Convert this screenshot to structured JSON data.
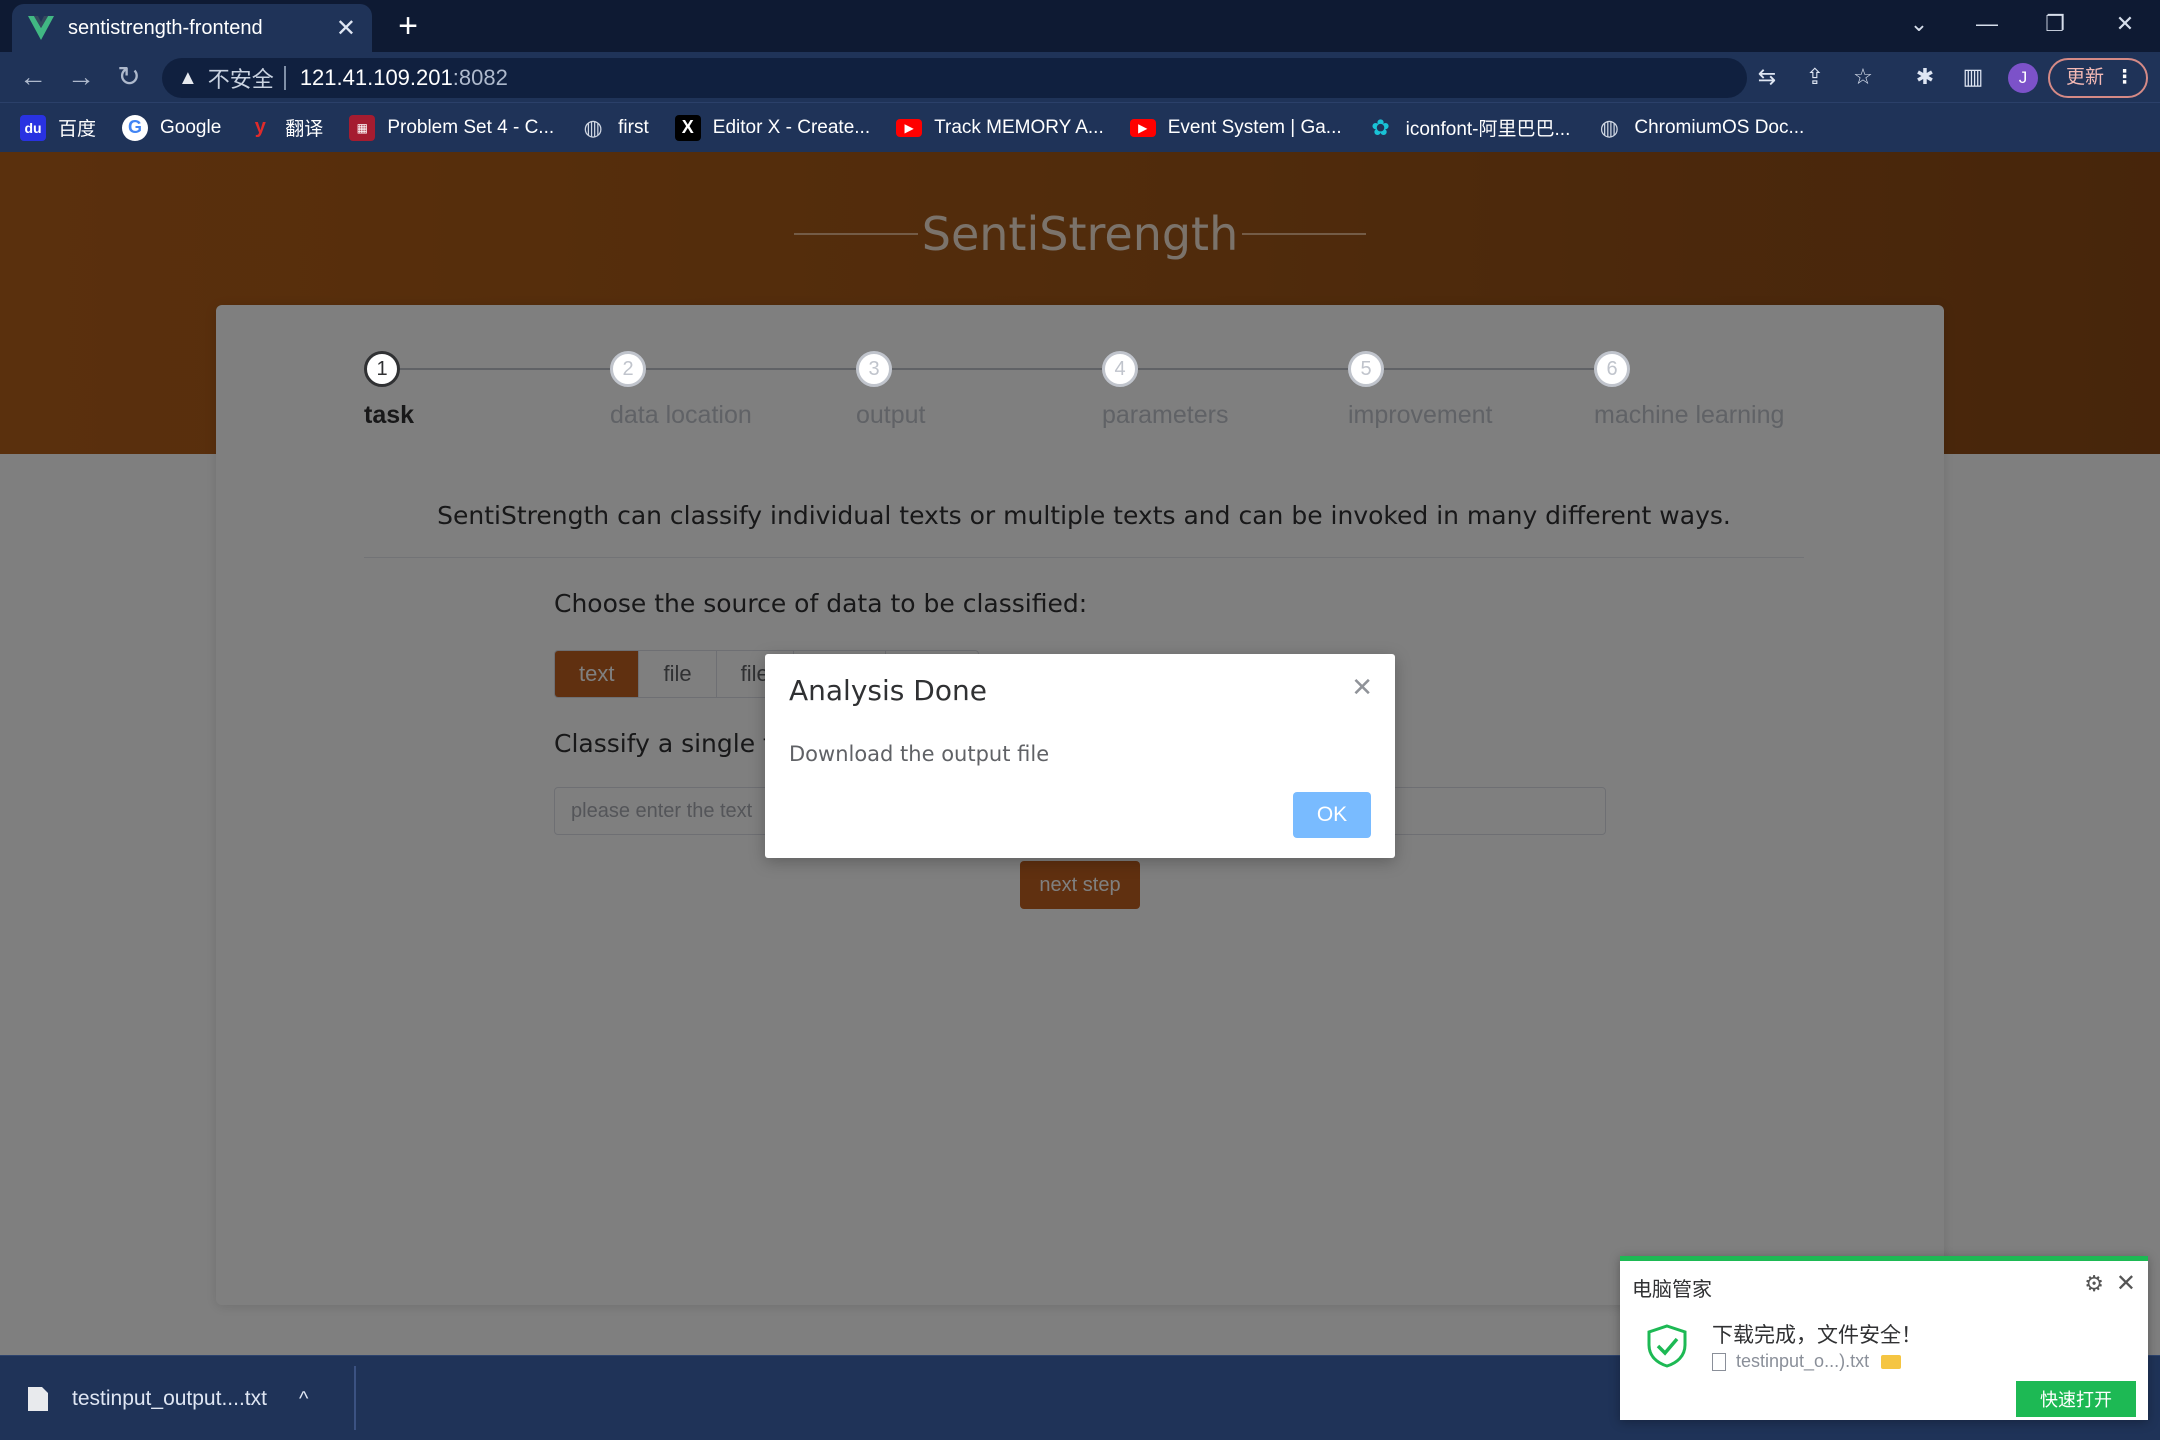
{
  "browser": {
    "tab_title": "sentistrength-frontend",
    "tab_close": "✕",
    "new_tab": "+",
    "address": {
      "security_label": "不安全",
      "host": "121.41.109.201",
      "port": ":8082"
    },
    "update_label": "更新",
    "profile_initial": "J",
    "bookmarks": [
      {
        "label": "百度",
        "icon": "baidu-icon",
        "color": "#2932e1"
      },
      {
        "label": "Google",
        "icon": "google-icon",
        "color": "#ffffff"
      },
      {
        "label": "翻译",
        "icon": "youdao-icon",
        "color": "#e02b2b"
      },
      {
        "label": "Problem Set 4 - C...",
        "icon": "harvard-icon",
        "color": "#a51c30"
      },
      {
        "label": "first",
        "icon": "globe-icon",
        "color": "#9aa5b8"
      },
      {
        "label": "Editor X - Create...",
        "icon": "editorx-icon",
        "color": "#000000"
      },
      {
        "label": "Track MEMORY A...",
        "icon": "youtube-icon",
        "color": "#ff0000"
      },
      {
        "label": "Event System | Ga...",
        "icon": "youtube-icon",
        "color": "#ff0000"
      },
      {
        "label": "iconfont-阿里巴巴...",
        "icon": "iconfont-icon",
        "color": "#19c2d6"
      },
      {
        "label": "ChromiumOS Doc...",
        "icon": "globe-icon",
        "color": "#9aa5b8"
      }
    ]
  },
  "app": {
    "brand": "SentiStrength",
    "accent": "#c06020",
    "steps": [
      {
        "num": "1",
        "label": "task",
        "active": true
      },
      {
        "num": "2",
        "label": "data location",
        "active": false
      },
      {
        "num": "3",
        "label": "output",
        "active": false
      },
      {
        "num": "4",
        "label": "parameters",
        "active": false
      },
      {
        "num": "5",
        "label": "improvement",
        "active": false
      },
      {
        "num": "6",
        "label": "machine learning",
        "active": false
      }
    ],
    "description": "SentiStrength can classify individual texts or multiple texts and can be invoked in many different ways.",
    "choose_label": "Choose the source of data to be classified:",
    "source_options": [
      "text",
      "file",
      "file",
      "",
      ""
    ],
    "selected_source": "text",
    "classify_label": "Classify a single text",
    "text_input_placeholder": "please enter the text",
    "next_button": "next step"
  },
  "dialog": {
    "title": "Analysis Done",
    "message": "Download the output file",
    "ok_label": "OK",
    "close": "✕"
  },
  "download_bar": {
    "filename": "testinput_output....txt",
    "caret": "^"
  },
  "toast": {
    "title": "电脑管家",
    "message": "下载完成，文件安全！",
    "file": "testinput_o...).txt",
    "open_label": "快速打开"
  }
}
